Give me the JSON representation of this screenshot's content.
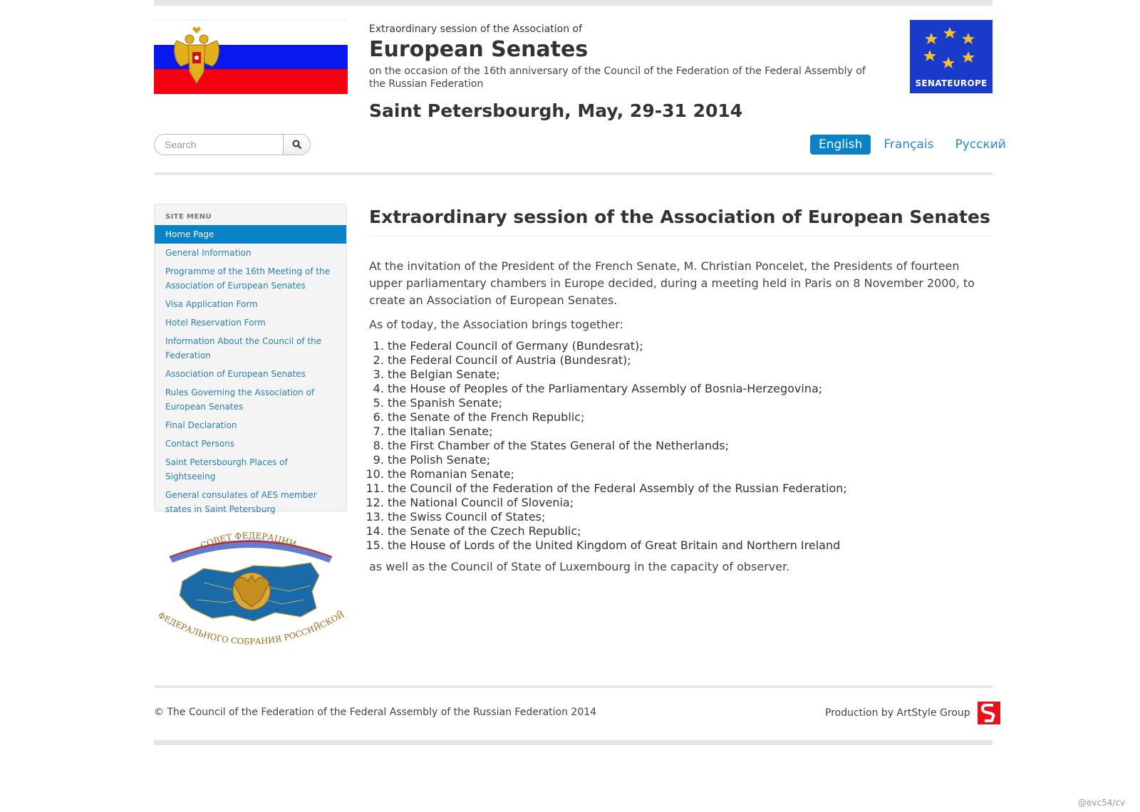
{
  "header": {
    "pre_title": "Extraordinary session of the Association of",
    "title": "European Senates",
    "subtitle": "on the occasion of the 16th anniversary of the Council of the Federation of the Federal Assembly of the Russian Federation",
    "city_date": "Saint Petersbourgh, May, 29-31 2014",
    "logo_text": "SENATEUROPE"
  },
  "search": {
    "placeholder": "Search"
  },
  "languages": [
    {
      "label": "English",
      "active": true
    },
    {
      "label": "Français",
      "active": false
    },
    {
      "label": "Русский",
      "active": false
    }
  ],
  "sidebar": {
    "title": "SITE MENU",
    "items": [
      "Home Page",
      "General Information",
      "Programme of the 16th Meeting of the Association of European Senates",
      "Visa Application Form",
      "Hotel Reservation Form",
      "Information About the Council of the Federation",
      "Association of European Senates",
      "Rules Governing the Association of European Senates",
      "Final Declaration",
      "Contact Persons",
      "Saint Petersbourgh Places of Sightseeing",
      "General consulates of AES member states in Saint Petersburg"
    ]
  },
  "council_logo": {
    "top_text": "СОВЕТ ФЕДЕРАЦИИ",
    "bottom_text": "ФЕДЕРАЛЬНОГО СОБРАНИЯ РОССИЙСКОЙ ФЕДЕРАЦИИ"
  },
  "content": {
    "heading": "Extraordinary session of the Association of European Senates",
    "p1": "At the invitation of the President of the French Senate, M. Christian Poncelet, the Presidents of fourteen upper parliamentary chambers in Europe decided, during a meeting held in Paris on 8 November 2000, to create an Association of European Senates.",
    "p2": "As of today, the Association brings together:",
    "members": [
      "the Federal Council of Germany (Bundesrat);",
      "the Federal Council of Austria (Bundesrat);",
      "the Belgian Senate;",
      "the House of Peoples of the Parliamentary Assembly of Bosnia-Herzegovina;",
      "the Spanish Senate;",
      "the Senate of the French Republic;",
      "the Italian Senate;",
      "the First Chamber of the States General of the Netherlands;",
      "the Polish Senate;",
      "the Romanian Senate;",
      "the Council of the Federation of the Federal Assembly of the Russian Federation;",
      "the National Council of Slovenia;",
      "the Swiss Council of States;",
      "the Senate of the Czech Republic;",
      "the House of Lords of the United Kingdom of Great Britain and Northern Ireland"
    ],
    "p3": "as well as the Council of State of Luxembourg in the capacity of observer."
  },
  "footer": {
    "copyright": "© The Council of the Federation of the Federal Assembly of the Russian Federation 2014",
    "production": "Production by ArtStyle Group"
  },
  "watermark": "@evc54/cv",
  "colors": {
    "accent": "#0a82c8",
    "link": "#2a7fb5",
    "flag_blue": "#0a18f0",
    "flag_red": "#f50010",
    "senat_blue": "#1a3bc9"
  }
}
